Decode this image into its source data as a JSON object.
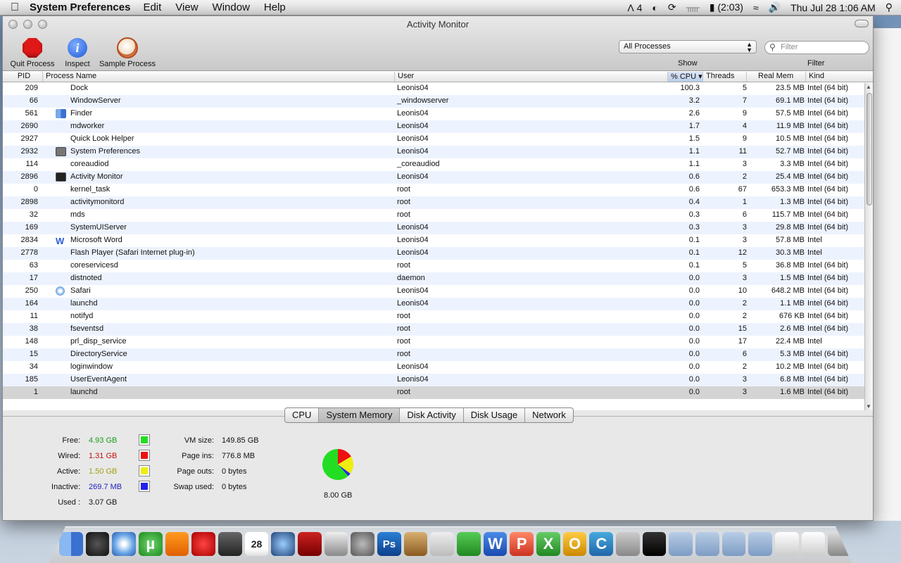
{
  "menubar": {
    "app_name": "System Preferences",
    "menus": [
      "Edit",
      "View",
      "Window",
      "Help"
    ],
    "adobe_count": "4",
    "battery": "(2:03)",
    "clock": "Thu Jul 28  1:06 AM"
  },
  "window": {
    "title": "Activity Monitor",
    "toolbar": {
      "quit": "Quit Process",
      "inspect": "Inspect",
      "sample": "Sample Process"
    },
    "show_select": "All Processes",
    "show_label": "Show",
    "filter_placeholder": "Filter",
    "filter_label": "Filter"
  },
  "table": {
    "columns": [
      "PID",
      "Process Name",
      "User",
      "% CPU ▾",
      "Threads",
      "Real Mem",
      "Kind"
    ],
    "rows": [
      {
        "pid": "209",
        "name": "Dock",
        "icon": "",
        "user": "Leonis04",
        "cpu": "100.3",
        "threads": "5",
        "mem": "23.5 MB",
        "kind": "Intel (64 bit)"
      },
      {
        "pid": "66",
        "name": "WindowServer",
        "icon": "",
        "user": "_windowserver",
        "cpu": "3.2",
        "threads": "7",
        "mem": "69.1 MB",
        "kind": "Intel (64 bit)"
      },
      {
        "pid": "561",
        "name": "Finder",
        "icon": "finder",
        "user": "Leonis04",
        "cpu": "2.6",
        "threads": "9",
        "mem": "57.5 MB",
        "kind": "Intel (64 bit)"
      },
      {
        "pid": "2690",
        "name": "mdworker",
        "icon": "",
        "user": "Leonis04",
        "cpu": "1.7",
        "threads": "4",
        "mem": "11.9 MB",
        "kind": "Intel (64 bit)"
      },
      {
        "pid": "2927",
        "name": "Quick Look Helper",
        "icon": "",
        "user": "Leonis04",
        "cpu": "1.5",
        "threads": "9",
        "mem": "10.5 MB",
        "kind": "Intel (64 bit)"
      },
      {
        "pid": "2932",
        "name": "System Preferences",
        "icon": "syspref",
        "user": "Leonis04",
        "cpu": "1.1",
        "threads": "11",
        "mem": "52.7 MB",
        "kind": "Intel (64 bit)"
      },
      {
        "pid": "114",
        "name": "coreaudiod",
        "icon": "",
        "user": "_coreaudiod",
        "cpu": "1.1",
        "threads": "3",
        "mem": "3.3 MB",
        "kind": "Intel (64 bit)"
      },
      {
        "pid": "2896",
        "name": "Activity Monitor",
        "icon": "am",
        "user": "Leonis04",
        "cpu": "0.6",
        "threads": "2",
        "mem": "25.4 MB",
        "kind": "Intel (64 bit)"
      },
      {
        "pid": "0",
        "name": "kernel_task",
        "icon": "",
        "user": "root",
        "cpu": "0.6",
        "threads": "67",
        "mem": "653.3 MB",
        "kind": "Intel (64 bit)"
      },
      {
        "pid": "2898",
        "name": "activitymonitord",
        "icon": "",
        "user": "root",
        "cpu": "0.4",
        "threads": "1",
        "mem": "1.3 MB",
        "kind": "Intel (64 bit)"
      },
      {
        "pid": "32",
        "name": "mds",
        "icon": "",
        "user": "root",
        "cpu": "0.3",
        "threads": "6",
        "mem": "115.7 MB",
        "kind": "Intel (64 bit)"
      },
      {
        "pid": "169",
        "name": "SystemUIServer",
        "icon": "",
        "user": "Leonis04",
        "cpu": "0.3",
        "threads": "3",
        "mem": "29.8 MB",
        "kind": "Intel (64 bit)"
      },
      {
        "pid": "2834",
        "name": "Microsoft Word",
        "icon": "word",
        "user": "Leonis04",
        "cpu": "0.1",
        "threads": "3",
        "mem": "57.8 MB",
        "kind": "Intel"
      },
      {
        "pid": "2778",
        "name": "Flash Player (Safari Internet plug-in)",
        "icon": "",
        "user": "Leonis04",
        "cpu": "0.1",
        "threads": "12",
        "mem": "30.3 MB",
        "kind": "Intel"
      },
      {
        "pid": "63",
        "name": "coreservicesd",
        "icon": "",
        "user": "root",
        "cpu": "0.1",
        "threads": "5",
        "mem": "36.8 MB",
        "kind": "Intel (64 bit)"
      },
      {
        "pid": "17",
        "name": "distnoted",
        "icon": "",
        "user": "daemon",
        "cpu": "0.0",
        "threads": "3",
        "mem": "1.5 MB",
        "kind": "Intel (64 bit)"
      },
      {
        "pid": "250",
        "name": "Safari",
        "icon": "safari",
        "user": "Leonis04",
        "cpu": "0.0",
        "threads": "10",
        "mem": "648.2 MB",
        "kind": "Intel (64 bit)"
      },
      {
        "pid": "164",
        "name": "launchd",
        "icon": "",
        "user": "Leonis04",
        "cpu": "0.0",
        "threads": "2",
        "mem": "1.1 MB",
        "kind": "Intel (64 bit)"
      },
      {
        "pid": "11",
        "name": "notifyd",
        "icon": "",
        "user": "root",
        "cpu": "0.0",
        "threads": "2",
        "mem": "676 KB",
        "kind": "Intel (64 bit)"
      },
      {
        "pid": "38",
        "name": "fseventsd",
        "icon": "",
        "user": "root",
        "cpu": "0.0",
        "threads": "15",
        "mem": "2.6 MB",
        "kind": "Intel (64 bit)"
      },
      {
        "pid": "148",
        "name": "prl_disp_service",
        "icon": "",
        "user": "root",
        "cpu": "0.0",
        "threads": "17",
        "mem": "22.4 MB",
        "kind": "Intel"
      },
      {
        "pid": "15",
        "name": "DirectoryService",
        "icon": "",
        "user": "root",
        "cpu": "0.0",
        "threads": "6",
        "mem": "5.3 MB",
        "kind": "Intel (64 bit)"
      },
      {
        "pid": "34",
        "name": "loginwindow",
        "icon": "",
        "user": "Leonis04",
        "cpu": "0.0",
        "threads": "2",
        "mem": "10.2 MB",
        "kind": "Intel (64 bit)"
      },
      {
        "pid": "185",
        "name": "UserEventAgent",
        "icon": "",
        "user": "Leonis04",
        "cpu": "0.0",
        "threads": "3",
        "mem": "6.8 MB",
        "kind": "Intel (64 bit)"
      },
      {
        "pid": "1",
        "name": "launchd",
        "icon": "",
        "user": "root",
        "cpu": "0.0",
        "threads": "3",
        "mem": "1.6 MB",
        "kind": "Intel (64 bit)"
      }
    ]
  },
  "tabs": [
    "CPU",
    "System Memory",
    "Disk Activity",
    "Disk Usage",
    "Network"
  ],
  "memory": {
    "free_label": "Free:",
    "free": "4.93 GB",
    "wired_label": "Wired:",
    "wired": "1.31 GB",
    "active_label": "Active:",
    "active": "1.50 GB",
    "inactive_label": "Inactive:",
    "inactive": "269.7 MB",
    "used_label": "Used :",
    "used": "3.07 GB",
    "vm_label": "VM size:",
    "vm": "149.85 GB",
    "pageins_label": "Page ins:",
    "pageins": "776.8 MB",
    "pageouts_label": "Page outs:",
    "pageouts": "0 bytes",
    "swap_label": "Swap used:",
    "swap": "0 bytes",
    "total": "8.00 GB",
    "colors": {
      "free": "#22dd22",
      "wired": "#ee1111",
      "active": "#eeee11",
      "inactive": "#2222ee"
    },
    "values_gb": {
      "free": 4.93,
      "wired": 1.31,
      "active": 1.5,
      "inactive": 0.2634
    }
  },
  "dock": {
    "icons": [
      "finder-icon",
      "dashboard-icon",
      "safari-icon",
      "utorrent-icon",
      "vlc-icon",
      "angry-birds-icon",
      "facetime-icon",
      "ical-icon",
      "itunes-icon",
      "photo-booth-icon",
      "iphoto-icon",
      "system-preferences-icon",
      "photoshop-icon",
      "keynote-icon",
      "pages-icon",
      "numbers-icon",
      "word-icon",
      "powerpoint-icon",
      "excel-icon",
      "outlook-icon",
      "chrome-icon",
      "automator-icon",
      "activity-monitor-icon",
      "applications-folder-icon",
      "documents-folder-icon",
      "downloads-folder-icon",
      "folder-icon",
      "stack-icon",
      "stack-icon-2",
      "trash-icon"
    ],
    "ical_day": "28",
    "word_glyph": "W",
    "ppt_glyph": "P",
    "excel_glyph": "X",
    "outlook_glyph": "O",
    "chrome_glyph": "C",
    "utorrent_glyph": "µ",
    "ps_glyph": "Ps"
  }
}
